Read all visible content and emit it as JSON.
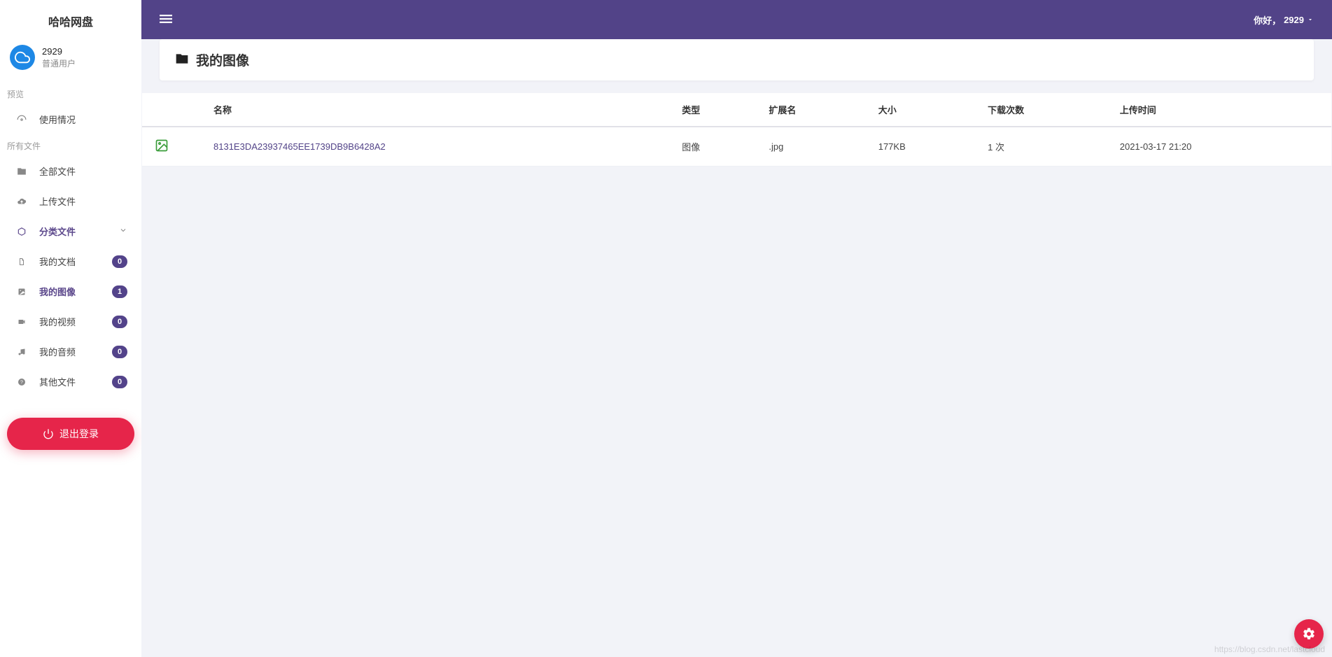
{
  "brand": "哈哈网盘",
  "user": {
    "name": "2929",
    "role": "普通用户"
  },
  "sections": {
    "preview": "预览",
    "allfiles": "所有文件"
  },
  "nav": {
    "usage": "使用情况",
    "all": "全部文件",
    "upload": "上传文件",
    "category": "分类文件",
    "sub": {
      "docs": {
        "label": "我的文档",
        "count": "0"
      },
      "images": {
        "label": "我的图像",
        "count": "1"
      },
      "videos": {
        "label": "我的视频",
        "count": "0"
      },
      "audio": {
        "label": "我的音频",
        "count": "0"
      },
      "other": {
        "label": "其他文件",
        "count": "0"
      }
    }
  },
  "logout": "退出登录",
  "header": {
    "greeting_prefix": "你好，",
    "username": "2929"
  },
  "page": {
    "title": "我的图像"
  },
  "table": {
    "headers": {
      "name": "名称",
      "type": "类型",
      "ext": "扩展名",
      "size": "大小",
      "downloads": "下载次数",
      "uploaded": "上传时间"
    },
    "rows": [
      {
        "name": "8131E3DA23937465EE1739DB9B6428A2",
        "type": "图像",
        "ext": ".jpg",
        "size": "177KB",
        "downloads": "1 次",
        "uploaded": "2021-03-17 21:20"
      }
    ]
  },
  "watermark": "https://blog.csdn.net/lastcloud"
}
